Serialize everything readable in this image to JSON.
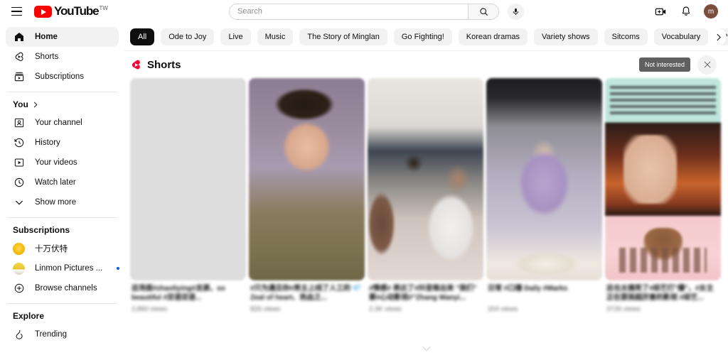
{
  "header": {
    "menu_icon": "hamburger-menu-icon",
    "logo_text": "YouTube",
    "logo_country": "TW",
    "search": {
      "value": "",
      "placeholder": "Search"
    },
    "search_icon": "search-icon",
    "mic_icon": "microphone-icon",
    "create_icon": "create-video-icon",
    "notifications_icon": "bell-icon",
    "avatar_initial": "m"
  },
  "sidebar": {
    "primary": [
      {
        "label": "Home",
        "icon": "home-icon",
        "active": true
      },
      {
        "label": "Shorts",
        "icon": "shorts-icon",
        "active": false
      },
      {
        "label": "Subscriptions",
        "icon": "subscriptions-icon",
        "active": false
      }
    ],
    "you_section": {
      "title": "You",
      "chevron": "chevron-right-icon"
    },
    "you_items": [
      {
        "label": "Your channel",
        "icon": "person-box-icon"
      },
      {
        "label": "History",
        "icon": "history-clock-icon"
      },
      {
        "label": "Your videos",
        "icon": "play-box-icon"
      },
      {
        "label": "Watch later",
        "icon": "clock-icon"
      },
      {
        "label": "Show more",
        "icon": "chevron-down-icon"
      }
    ],
    "subscriptions_title": "Subscriptions",
    "subscriptions": [
      {
        "label": "十万伏特",
        "icon": "channel-avatar",
        "has_new": false
      },
      {
        "label": "Linmon Pictures ...",
        "icon": "channel-avatar",
        "has_new": true
      },
      {
        "label": "Browse channels",
        "icon": "plus-circle-icon",
        "has_new": false
      }
    ],
    "explore_title": "Explore",
    "explore": [
      {
        "label": "Trending",
        "icon": "trending-icon"
      }
    ]
  },
  "chips": [
    {
      "label": "All",
      "selected": true
    },
    {
      "label": "Ode to Joy",
      "selected": false
    },
    {
      "label": "Live",
      "selected": false
    },
    {
      "label": "Music",
      "selected": false
    },
    {
      "label": "The Story of Minglan",
      "selected": false
    },
    {
      "label": "Go Fighting!",
      "selected": false
    },
    {
      "label": "Korean dramas",
      "selected": false
    },
    {
      "label": "Variety shows",
      "selected": false
    },
    {
      "label": "Sitcoms",
      "selected": false
    },
    {
      "label": "Vocabulary",
      "selected": false
    },
    {
      "label": "Playlists",
      "selected": false
    }
  ],
  "chips_next_icon": "chevron-right-icon",
  "shorts_shelf": {
    "logo_icon": "shorts-logo-icon",
    "title": "Shorts",
    "not_interested_label": "Not interested",
    "close_icon": "close-icon",
    "expand_icon": "chevron-down-icon",
    "items": [
      {
        "title": "这场面#zhaoliying#龙源，so beautiful #双语双语...",
        "views": "2,860 views",
        "thumb": "t1"
      },
      {
        "title": "#只为遇见你#男主上线了人工的 💎 Zeal of heart、热血之...",
        "views": "826 views",
        "thumb": "t2"
      },
      {
        "title": "#情感# 表达了#抖音推出来 \"我们\" 要#心动影视#\"Zhang Wanyi...",
        "views": "2.3K views",
        "thumb": "t3"
      },
      {
        "title": "日常 #口播 Daily #Marks",
        "views": "204 views",
        "thumb": "t4"
      },
      {
        "title": "这也太搞笑了#综艺打\"爆\"，#女主正在耍我超厉害的影视 #综艺...",
        "views": "3726 views",
        "thumb": "t5"
      }
    ]
  }
}
